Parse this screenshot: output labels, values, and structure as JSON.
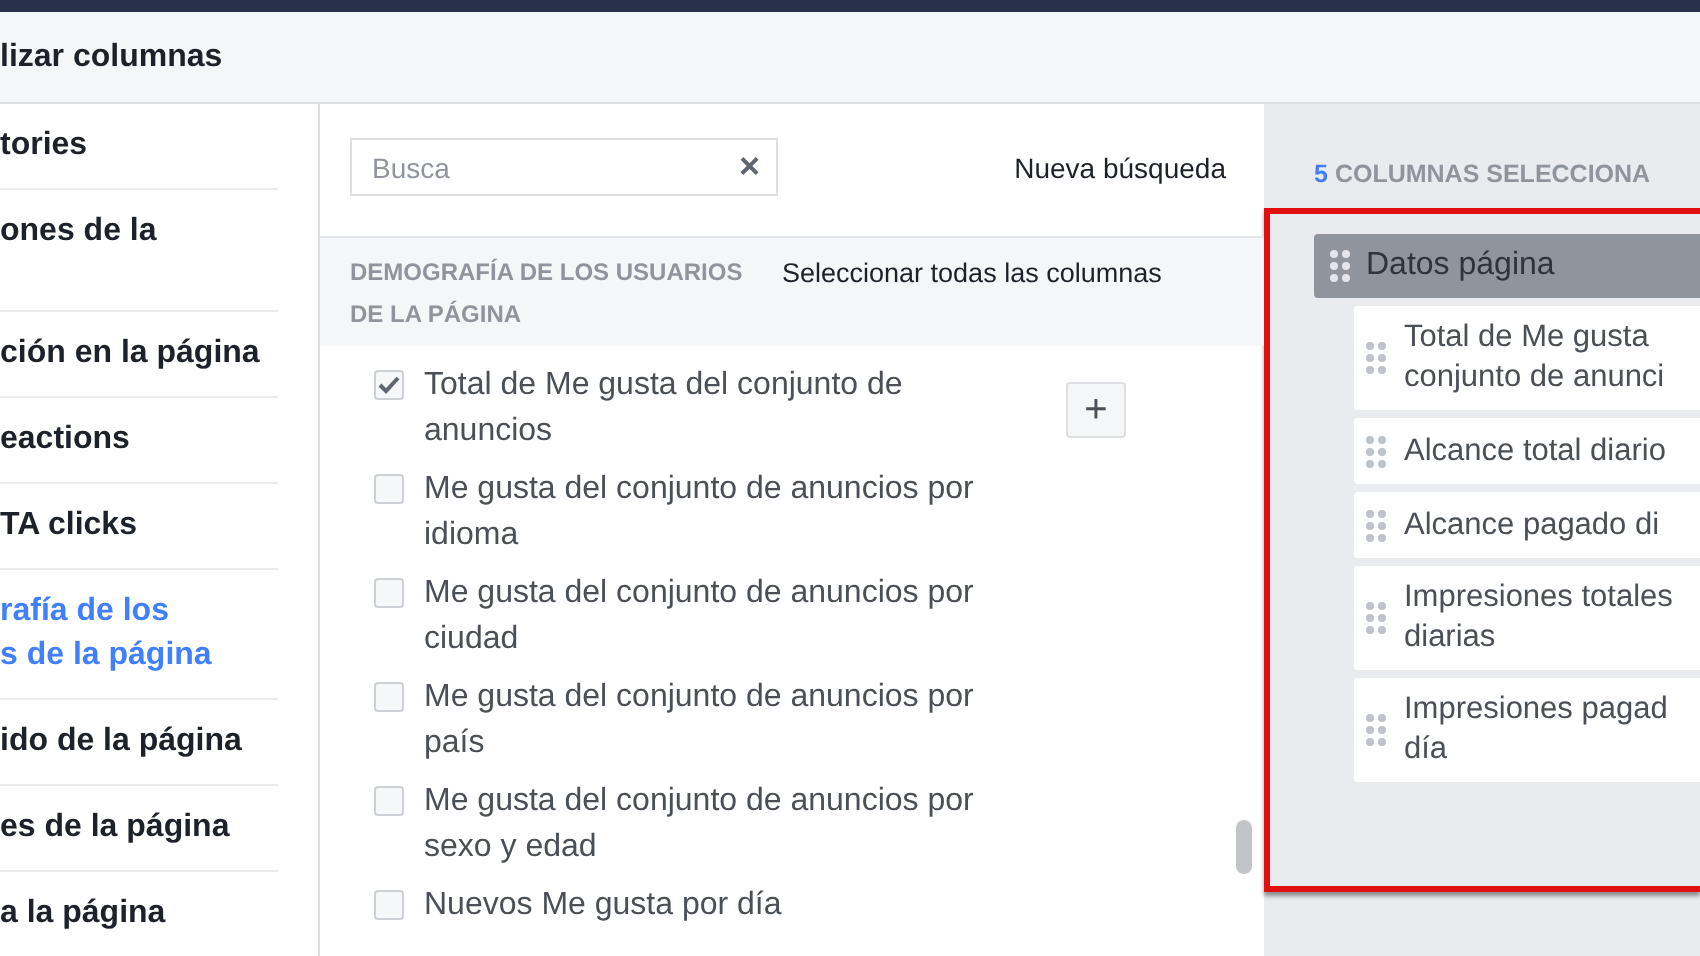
{
  "window": {
    "title": "lizar columnas"
  },
  "sidebar": {
    "items": [
      {
        "label": "tories",
        "selected": false
      },
      {
        "label": "ones de la",
        "selected": false
      },
      {
        "label": "ción en la página",
        "selected": false
      },
      {
        "label": "eactions",
        "selected": false
      },
      {
        "label": "TA clicks",
        "selected": false
      },
      {
        "label": "rafía de los\ns de la página",
        "selected": true
      },
      {
        "label": "ido de la página",
        "selected": false
      },
      {
        "label": "es de la página",
        "selected": false
      },
      {
        "label": "a la página",
        "selected": false
      }
    ]
  },
  "search": {
    "placeholder": "Busca",
    "clear": "×",
    "new_search": "Nueva búsqueda"
  },
  "section": {
    "title": "DEMOGRAFÍA DE LOS USUARIOS DE LA PÁGINA",
    "select_all": "Seleccionar todas las columnas",
    "add_button": "+"
  },
  "options": [
    {
      "label": "Total de Me gusta del conjunto de\nanuncios",
      "checked": true
    },
    {
      "label": "Me gusta del conjunto de anuncios por\nidioma",
      "checked": false
    },
    {
      "label": "Me gusta del conjunto de anuncios por\nciudad",
      "checked": false
    },
    {
      "label": "Me gusta del conjunto de anuncios por\npaís",
      "checked": false
    },
    {
      "label": "Me gusta del conjunto de anuncios por\nsexo y edad",
      "checked": false
    },
    {
      "label": "Nuevos Me gusta por día",
      "checked": false
    }
  ],
  "selected_panel": {
    "count": "5",
    "title": "COLUMNAS SELECCIONA",
    "group": "Datos página",
    "columns": [
      "Total de Me gusta\nconjunto de anunci",
      "Alcance total diario",
      "Alcance pagado di",
      "Impresiones totales\ndiarias",
      "Impresiones pagad\ndía"
    ]
  }
}
